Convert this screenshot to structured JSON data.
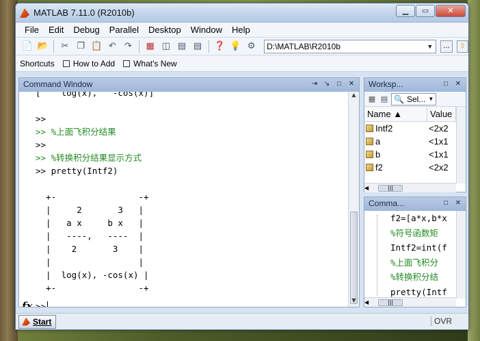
{
  "window": {
    "title": "MATLAB  7.11.0 (R2010b)"
  },
  "window_controls": {
    "minimize": "▁",
    "maximize": "▭",
    "close": "✕"
  },
  "menu": [
    "File",
    "Edit",
    "Debug",
    "Parallel",
    "Desktop",
    "Window",
    "Help"
  ],
  "toolbar": {
    "current_folder": "D:\\MATLAB\\R2010b",
    "browse_label": "...",
    "icons": [
      "new-file-icon",
      "open-folder-icon",
      "cut-icon",
      "copy-icon",
      "paste-icon",
      "undo-icon",
      "redo-icon",
      "simulink-icon",
      "guide-icon",
      "profiler-icon",
      "help-icon",
      "lightbulb-icon",
      "settings-icon",
      "folder-up-icon"
    ]
  },
  "shortcuts": {
    "label": "Shortcuts",
    "items": [
      "How to Add",
      "What's New"
    ]
  },
  "command_window": {
    "title": "Command Window",
    "lines": [
      {
        "text": "[    log(x),   -cos(x)]",
        "type": "code"
      },
      {
        "text": "",
        "type": "code"
      },
      {
        "text": ">>",
        "type": "code"
      },
      {
        "text": ">> %上面飞积分结果",
        "type": "comment"
      },
      {
        "text": ">>",
        "type": "code"
      },
      {
        "text": ">> %转换积分结果显示方式",
        "type": "comment"
      },
      {
        "text": ">> pretty(Intf2)",
        "type": "code"
      },
      {
        "text": "",
        "type": "code"
      },
      {
        "text": "  +-                -+",
        "type": "code"
      },
      {
        "text": "  |     2       3   |",
        "type": "code"
      },
      {
        "text": "  |   a x     b x   |",
        "type": "code"
      },
      {
        "text": "  |   ----,   ----  |",
        "type": "code"
      },
      {
        "text": "  |    2       3    |",
        "type": "code"
      },
      {
        "text": "  |                 |",
        "type": "code"
      },
      {
        "text": "  |  log(x), -cos(x) |",
        "type": "code"
      },
      {
        "text": "  +-                -+",
        "type": "code"
      }
    ],
    "fx_label": "fx",
    "prompt": ">>"
  },
  "workspace": {
    "title": "Worksp...",
    "select_label": "Sel...",
    "columns": {
      "name": "Name ▲",
      "value": "Value"
    },
    "variables": [
      {
        "name": "Intf2",
        "value": "<2x2"
      },
      {
        "name": "a",
        "value": "<1x1"
      },
      {
        "name": "b",
        "value": "<1x1"
      },
      {
        "name": "f2",
        "value": "<2x2"
      }
    ]
  },
  "command_history": {
    "title": "Comma...",
    "lines": [
      {
        "text": "f2=[a*x,b*x",
        "type": "code"
      },
      {
        "text": "%符号函数矩",
        "type": "comment"
      },
      {
        "text": "Intf2=int(f",
        "type": "code"
      },
      {
        "text": "%上面飞积分",
        "type": "comment"
      },
      {
        "text": "%转换积分结",
        "type": "comment"
      },
      {
        "text": "pretty(Intf",
        "type": "code"
      }
    ]
  },
  "status": {
    "start_label": "Start",
    "mode": "OVR"
  }
}
